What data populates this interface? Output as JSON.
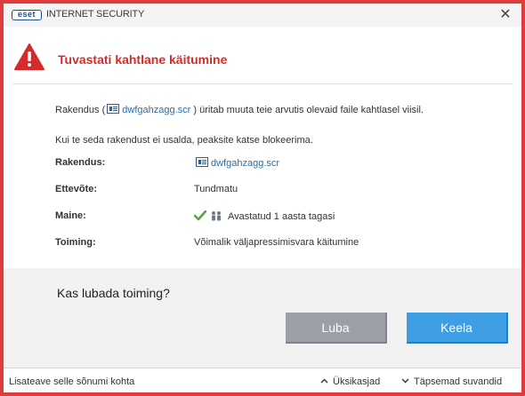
{
  "window": {
    "logo_text": "eset",
    "app_title": "INTERNET SECURITY",
    "close_glyph": "✕"
  },
  "header": {
    "title": "Tuvastati kahtlane käitumine",
    "icon": "warning-icon",
    "accent_color": "#d62b2b"
  },
  "message": {
    "line1_prefix": "Rakendus (",
    "line1_file": "dwfgahzagg.scr",
    "line1_suffix": " ) üritab muuta teie arvutis olevaid faile kahtlasel viisil.",
    "line2": "Kui te seda rakendust ei usalda, peaksite katse blokeerima."
  },
  "details": {
    "application_label": "Rakendus:",
    "application_value": "dwfgahzagg.scr",
    "company_label": "Ettevõte:",
    "company_value": "Tundmatu",
    "reputation_label": "Maine:",
    "reputation_value": "Avastatud 1 aasta tagasi",
    "action_label": "Toiming:",
    "action_value": "Võimalik väljapressimisvara käitumine"
  },
  "prompt": {
    "question": "Kas lubada toiming?",
    "allow_label": "Luba",
    "block_label": "Keela",
    "allow_color": "#9aa0a5",
    "block_color": "#3d9ee3"
  },
  "footer": {
    "learn_more": "Lisateave selle sõnumi kohta",
    "details_toggle": "Üksikasjad",
    "advanced_toggle": "Täpsemad suvandid"
  }
}
